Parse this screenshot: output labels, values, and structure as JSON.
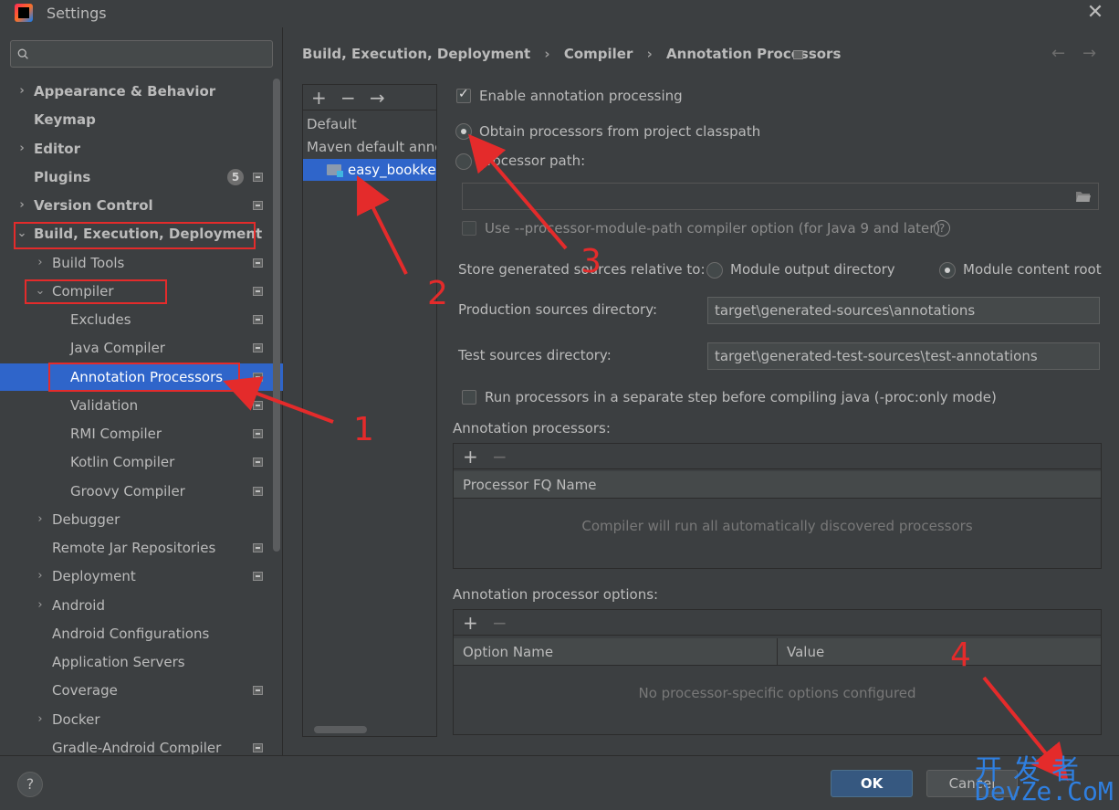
{
  "window": {
    "title": "Settings",
    "close_glyph": "✕"
  },
  "search": {
    "placeholder": ""
  },
  "sidebar": {
    "items": [
      {
        "label": "Appearance & Behavior",
        "expand": "›"
      },
      {
        "label": "Keymap"
      },
      {
        "label": "Editor",
        "expand": "›"
      },
      {
        "label": "Plugins",
        "badge": "5"
      },
      {
        "label": "Version Control",
        "expand": "›"
      },
      {
        "label": "Build, Execution, Deployment",
        "expand": "⌄"
      },
      {
        "label": "Build Tools",
        "expand": "›"
      },
      {
        "label": "Compiler",
        "expand": "⌄"
      },
      {
        "label": "Excludes"
      },
      {
        "label": "Java Compiler"
      },
      {
        "label": "Annotation Processors"
      },
      {
        "label": "Validation"
      },
      {
        "label": "RMI Compiler"
      },
      {
        "label": "Kotlin Compiler"
      },
      {
        "label": "Groovy Compiler"
      },
      {
        "label": "Debugger",
        "expand": "›"
      },
      {
        "label": "Remote Jar Repositories"
      },
      {
        "label": "Deployment",
        "expand": "›"
      },
      {
        "label": "Android",
        "expand": "›"
      },
      {
        "label": "Android Configurations"
      },
      {
        "label": "Application Servers"
      },
      {
        "label": "Coverage"
      },
      {
        "label": "Docker",
        "expand": "›"
      },
      {
        "label": "Gradle-Android Compiler"
      }
    ]
  },
  "breadcrumb": {
    "parts": [
      "Build, Execution, Deployment",
      "Compiler",
      "Annotation Processors"
    ],
    "sep": "›",
    "back": "←",
    "forward": "→"
  },
  "profiles": {
    "add": "+",
    "remove": "−",
    "move": "→",
    "items": [
      "Default",
      "Maven default annotation processors profile",
      "easy_bookkeeping"
    ]
  },
  "settings": {
    "enable_label": "Enable annotation processing",
    "obtain_label": "Obtain processors from project classpath",
    "path_label": "Processor path:",
    "path_value": "",
    "module_path_label": "Use --processor-module-path compiler option (for Java 9 and later)",
    "store_label": "Store generated sources relative to:",
    "module_output_label": "Module output directory",
    "module_content_label": "Module content root",
    "prod_dir_label": "Production sources directory:",
    "prod_dir_value": "target\\generated-sources\\annotations",
    "test_dir_label": "Test sources directory:",
    "test_dir_value": "target\\generated-test-sources\\test-annotations",
    "separate_step_label": "Run processors in a separate step before compiling java (-proc:only mode)",
    "processors_title": "Annotation processors:",
    "processors_col": "Processor FQ Name",
    "processors_empty": "Compiler will run all automatically discovered processors",
    "options_title": "Annotation processor options:",
    "options_col_name": "Option Name",
    "options_col_value": "Value",
    "options_empty": "No processor-specific options configured",
    "add": "+",
    "remove": "−"
  },
  "buttons": {
    "help": "?",
    "ok": "OK",
    "cancel": "Cancel"
  },
  "annotations": {
    "num1": "1",
    "num2": "2",
    "num3": "3",
    "num4": "4",
    "color": "#e42b2b"
  },
  "watermark": {
    "top": "开发者",
    "bottom": "DevZe.CoM"
  }
}
